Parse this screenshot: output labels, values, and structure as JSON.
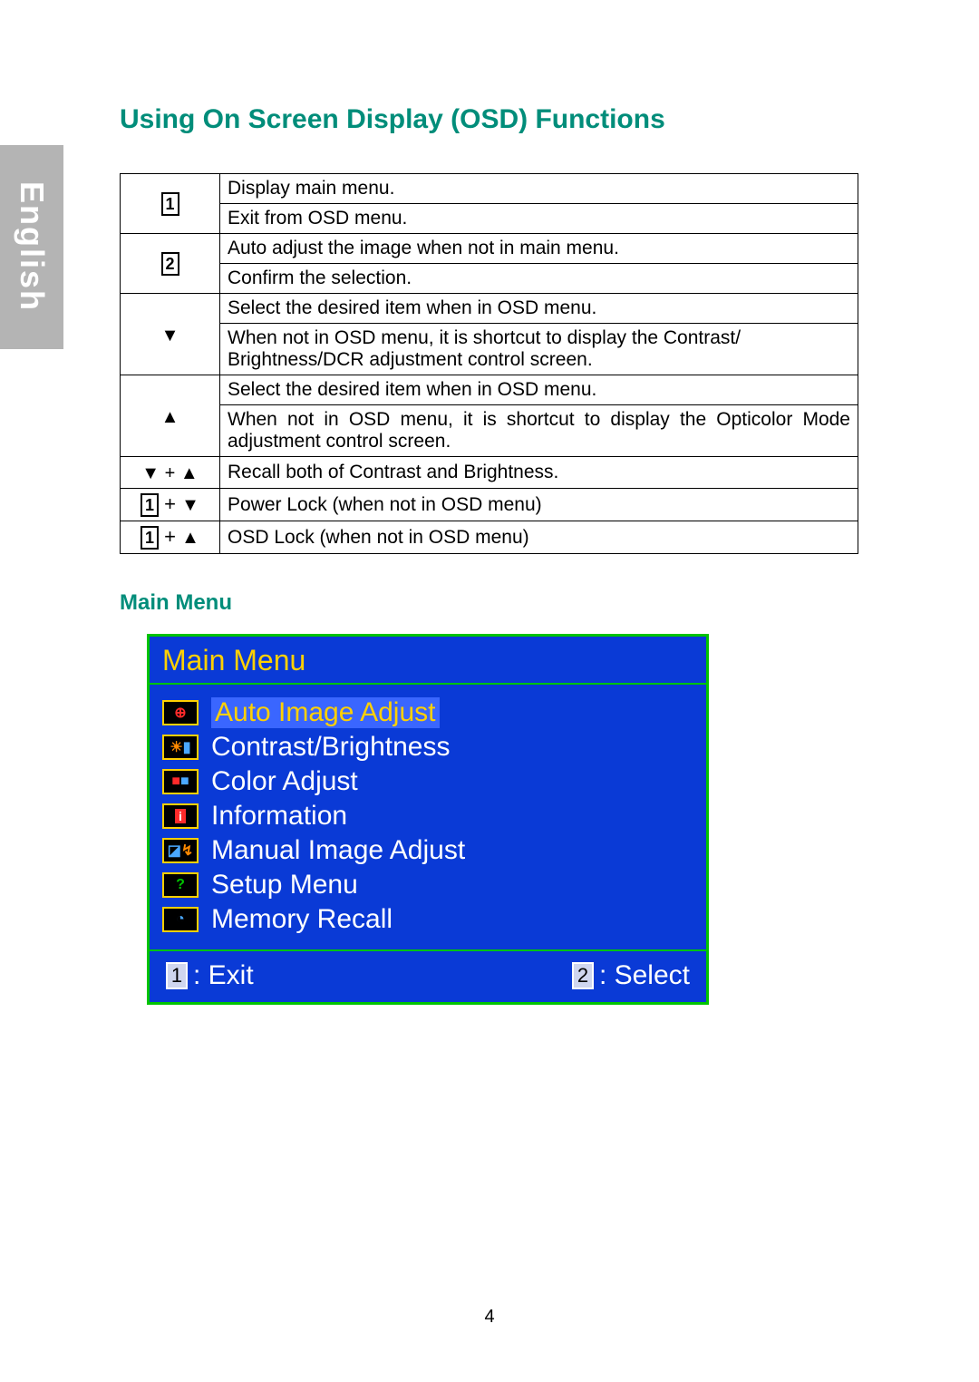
{
  "sidebar": {
    "language": "English"
  },
  "headings": {
    "page_title": "Using On Screen Display (OSD) Functions",
    "main_menu_heading": "Main Menu"
  },
  "buttons_table": {
    "rows": [
      {
        "key_type": "num",
        "key_label": "1",
        "descs": [
          "Display main menu.",
          "Exit from OSD menu."
        ]
      },
      {
        "key_type": "num",
        "key_label": "2",
        "descs": [
          "Auto adjust the image when not in main menu.",
          "Confirm the selection."
        ]
      },
      {
        "key_type": "arrow",
        "key_label": "▼",
        "descs": [
          "Select the desired item when in OSD menu.",
          "When not in OSD menu, it is shortcut to display the Contrast/ Brightness/DCR adjustment control screen."
        ]
      },
      {
        "key_type": "arrow",
        "key_label": "▲",
        "descs": [
          "Select the desired item when in OSD menu.",
          "When not in OSD menu, it is shortcut to display the Opticolor Mode adjustment control screen."
        ],
        "desc_justify": true
      },
      {
        "key_type": "combo_arrows",
        "key_label": "▼ + ▲",
        "descs": [
          "Recall both of Contrast and Brightness."
        ]
      },
      {
        "key_type": "combo_num_arrow",
        "key_num": "1",
        "key_arrow": "▼",
        "descs": [
          "Power Lock (when not in OSD menu)"
        ]
      },
      {
        "key_type": "combo_num_arrow",
        "key_num": "1",
        "key_arrow": "▲",
        "descs": [
          "OSD Lock (when not in OSD menu)"
        ]
      }
    ]
  },
  "osd": {
    "title": "Main Menu",
    "items": [
      {
        "label": "Auto Image Adjust",
        "icon": "auto-adjust-icon",
        "selected": true
      },
      {
        "label": "Contrast/Brightness",
        "icon": "brightness-icon",
        "selected": false
      },
      {
        "label": "Color Adjust",
        "icon": "color-adjust-icon",
        "selected": false
      },
      {
        "label": "Information",
        "icon": "info-icon",
        "selected": false
      },
      {
        "label": "Manual Image Adjust",
        "icon": "manual-adjust-icon",
        "selected": false
      },
      {
        "label": "Setup Menu",
        "icon": "setup-icon",
        "selected": false
      },
      {
        "label": "Memory Recall",
        "icon": "memory-recall-icon",
        "selected": false
      }
    ],
    "footer": {
      "left_key": "1",
      "left_label": ": Exit",
      "right_key": "2",
      "right_label": ": Select"
    }
  },
  "page_number": "4"
}
